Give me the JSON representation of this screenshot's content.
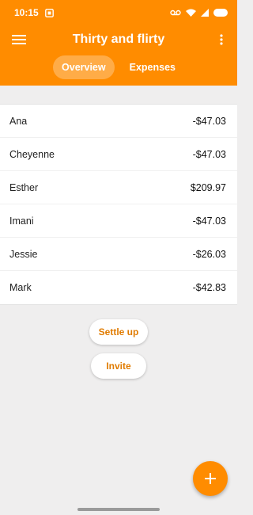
{
  "status_bar": {
    "time": "10:15",
    "icons": [
      "screenshot-icon",
      "voicemail-icon",
      "wifi-icon",
      "signal-icon",
      "battery-icon"
    ]
  },
  "app_bar": {
    "title": "Thirty and flirty",
    "menu_icon": "menu-icon",
    "overflow_icon": "more-vert-icon",
    "tabs": [
      {
        "label": "Overview",
        "active": true
      },
      {
        "label": "Expenses",
        "active": false
      }
    ]
  },
  "balances": [
    {
      "name": "Ana",
      "amount": "-$47.03"
    },
    {
      "name": "Cheyenne",
      "amount": "-$47.03"
    },
    {
      "name": "Esther",
      "amount": "$209.97"
    },
    {
      "name": "Imani",
      "amount": "-$47.03"
    },
    {
      "name": "Jessie",
      "amount": "-$26.03"
    },
    {
      "name": "Mark",
      "amount": "-$42.83"
    }
  ],
  "actions": {
    "settle_up": "Settle up",
    "invite": "Invite"
  },
  "fab": {
    "icon": "plus-icon"
  },
  "colors": {
    "primary": "#ff8c00",
    "accent_text": "#e07b00",
    "background": "#efeeee"
  }
}
